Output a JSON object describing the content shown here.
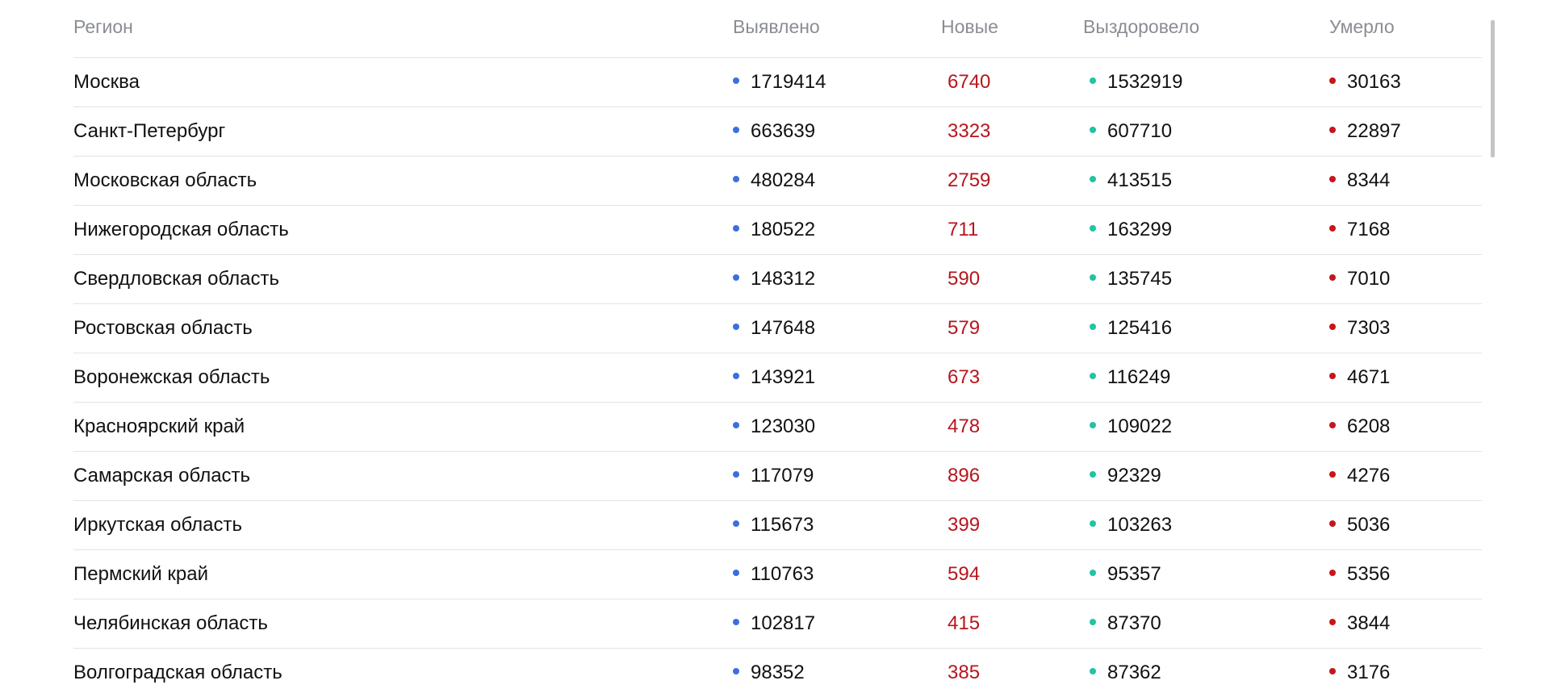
{
  "columns": {
    "region": "Регион",
    "detected": "Выявлено",
    "new": "Новые",
    "recovered": "Выздоровело",
    "died": "Умерло"
  },
  "colors": {
    "detected_dot": "#3b6fe0",
    "recovered_dot": "#20c4a4",
    "died_dot": "#c8151b",
    "new_text": "#b8151d",
    "header_text": "#8a8d93"
  },
  "rows": [
    {
      "region": "Москва",
      "detected": "1719414",
      "new": "6740",
      "recovered": "1532919",
      "died": "30163"
    },
    {
      "region": "Санкт-Петербург",
      "detected": "663639",
      "new": "3323",
      "recovered": "607710",
      "died": "22897"
    },
    {
      "region": "Московская область",
      "detected": "480284",
      "new": "2759",
      "recovered": "413515",
      "died": "8344"
    },
    {
      "region": "Нижегородская область",
      "detected": "180522",
      "new": "711",
      "recovered": "163299",
      "died": "7168"
    },
    {
      "region": "Свердловская область",
      "detected": "148312",
      "new": "590",
      "recovered": "135745",
      "died": "7010"
    },
    {
      "region": "Ростовская область",
      "detected": "147648",
      "new": "579",
      "recovered": "125416",
      "died": "7303"
    },
    {
      "region": "Воронежская область",
      "detected": "143921",
      "new": "673",
      "recovered": "116249",
      "died": "4671"
    },
    {
      "region": "Красноярский край",
      "detected": "123030",
      "new": "478",
      "recovered": "109022",
      "died": "6208"
    },
    {
      "region": "Самарская область",
      "detected": "117079",
      "new": "896",
      "recovered": "92329",
      "died": "4276"
    },
    {
      "region": "Иркутская область",
      "detected": "115673",
      "new": "399",
      "recovered": "103263",
      "died": "5036"
    },
    {
      "region": "Пермский край",
      "detected": "110763",
      "new": "594",
      "recovered": "95357",
      "died": "5356"
    },
    {
      "region": "Челябинская область",
      "detected": "102817",
      "new": "415",
      "recovered": "87370",
      "died": "3844"
    },
    {
      "region": "Волгоградская область",
      "detected": "98352",
      "new": "385",
      "recovered": "87362",
      "died": "3176"
    }
  ]
}
